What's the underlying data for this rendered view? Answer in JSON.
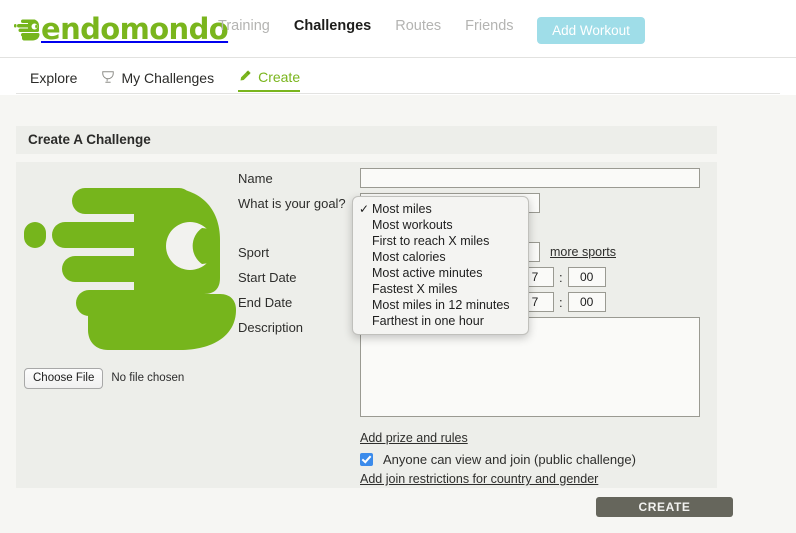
{
  "brand": {
    "name": "endomondo",
    "logo_color": "#7ab51d",
    "mascot_color": "#76b51c"
  },
  "topnav": {
    "items": [
      {
        "label": "Training",
        "active": false
      },
      {
        "label": "Challenges",
        "active": true
      },
      {
        "label": "Routes",
        "active": false
      },
      {
        "label": "Friends",
        "active": false
      }
    ],
    "add_workout_label": "Add Workout",
    "add_workout_color": "#9fdde8"
  },
  "subnav": {
    "items": [
      {
        "label": "Explore",
        "icon": null,
        "active": false
      },
      {
        "label": "My Challenges",
        "icon": "trophy-icon",
        "active": false
      },
      {
        "label": "Create",
        "icon": "pencil-icon",
        "active": true
      }
    ],
    "active_color": "#7ab51d"
  },
  "panel": {
    "title": "Create A Challenge",
    "header_bg": "#edeeea"
  },
  "form": {
    "name": {
      "label": "Name",
      "value": "",
      "placeholder": ""
    },
    "goal": {
      "label": "What is your goal?",
      "value": "Most miles"
    },
    "sport": {
      "label": "Sport",
      "value": "",
      "more_link": "more sports"
    },
    "start_date": {
      "label": "Start Date",
      "value": "",
      "hour": "7",
      "minute": "00"
    },
    "end_date": {
      "label": "End Date",
      "value": "",
      "hour": "7",
      "minute": "00"
    },
    "description": {
      "label": "Description",
      "value": "",
      "placeholder": ""
    },
    "prize_link": "Add prize and rules",
    "public_checkbox": {
      "label": "Anyone can view and join (public challenge)",
      "checked": true,
      "color": "#3b8beb"
    },
    "restrictions_link": "Add join restrictions for country and gender",
    "file": {
      "button_label": "Choose File",
      "status": "No file chosen"
    },
    "create_button": {
      "label": "CREATE",
      "color": "#66665c"
    }
  },
  "dropdown": {
    "open": true,
    "selected_index": 0,
    "check_glyph": "✓",
    "options": [
      "Most miles",
      "Most workouts",
      "First to reach X miles",
      "Most calories",
      "Most active minutes",
      "Fastest X miles",
      "Most miles in 12 minutes",
      "Farthest in one hour"
    ]
  }
}
